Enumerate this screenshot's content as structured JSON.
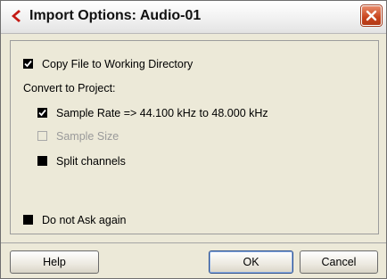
{
  "window": {
    "title": "Import Options: Audio-01",
    "close_icon": "close-icon"
  },
  "options": {
    "copy_file": {
      "label": "Copy File to Working Directory",
      "checked": true,
      "enabled": true
    },
    "convert_heading": "Convert to Project:",
    "sample_rate": {
      "label": "Sample Rate => 44.100 kHz to 48.000 kHz",
      "checked": true,
      "enabled": true
    },
    "sample_size": {
      "label": "Sample Size",
      "checked": false,
      "enabled": false
    },
    "split_channels": {
      "label": "Split channels",
      "checked": false,
      "enabled": true
    },
    "do_not_ask": {
      "label": "Do not Ask again",
      "checked": false,
      "enabled": true
    }
  },
  "buttons": {
    "help": "Help",
    "ok": "OK",
    "cancel": "Cancel"
  },
  "colors": {
    "dialog_bg": "#ece9d8",
    "logo_red": "#c41a14",
    "close_red": "#c8441d"
  }
}
